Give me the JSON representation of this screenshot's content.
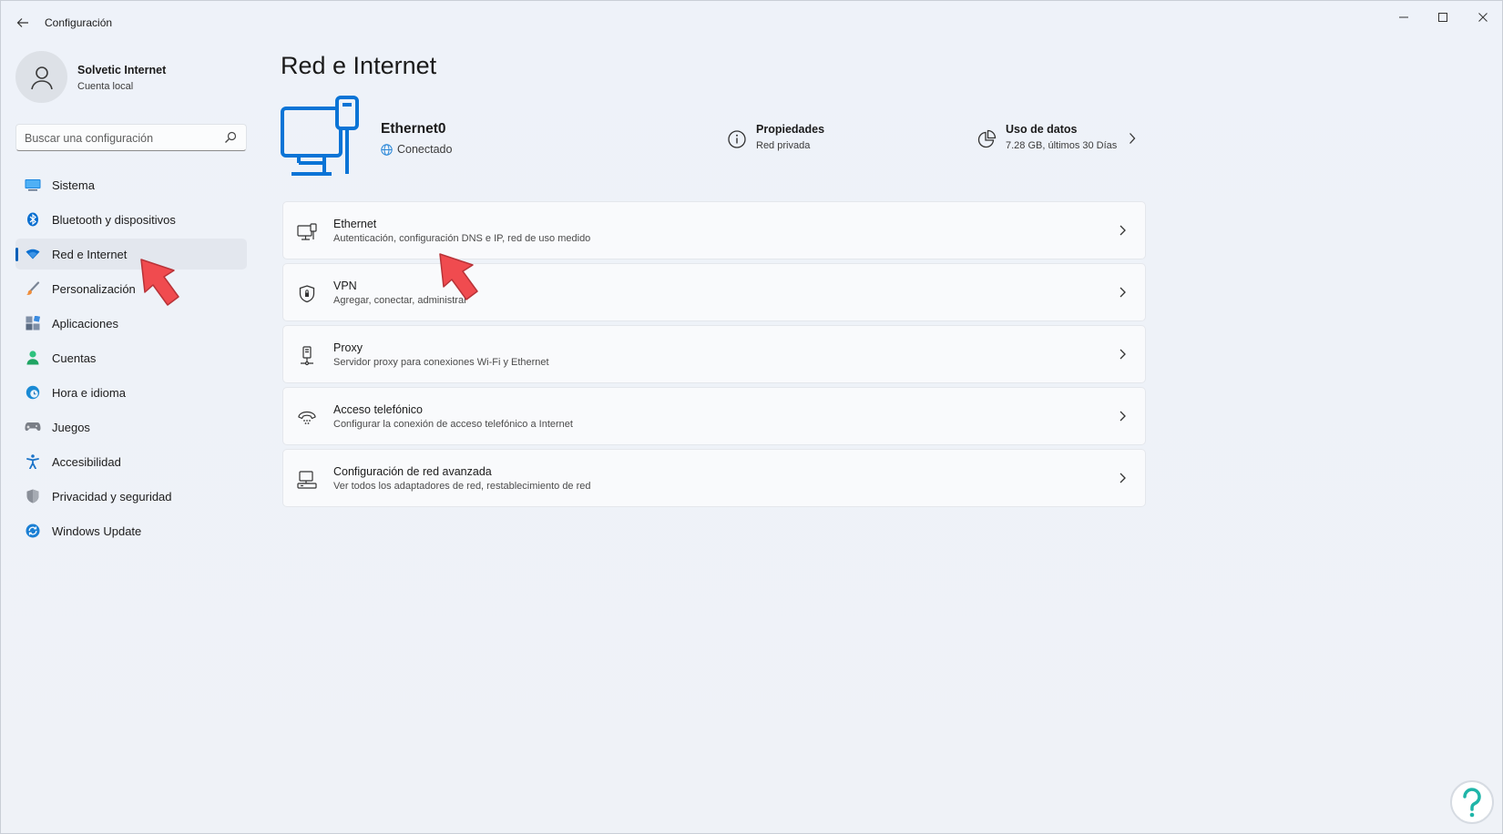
{
  "window": {
    "title": "Configuración",
    "controls": [
      "minimize",
      "maximize",
      "close"
    ]
  },
  "profile": {
    "name": "Solvetic Internet",
    "account_type": "Cuenta local"
  },
  "search": {
    "placeholder": "Buscar una configuración"
  },
  "sidebar": {
    "items": [
      {
        "label": "Sistema",
        "icon": "monitor-icon",
        "color": "#0078d4"
      },
      {
        "label": "Bluetooth y dispositivos",
        "icon": "bluetooth-icon",
        "color": "#0067c0"
      },
      {
        "label": "Red e Internet",
        "icon": "wifi-icon",
        "color": "#0067c0",
        "active": true
      },
      {
        "label": "Personalización",
        "icon": "brush-icon",
        "color": "#e8823a"
      },
      {
        "label": "Aplicaciones",
        "icon": "apps-icon",
        "color": "#5a6b82"
      },
      {
        "label": "Cuentas",
        "icon": "person-icon",
        "color": "#2bb673"
      },
      {
        "label": "Hora e idioma",
        "icon": "globe-clock-icon",
        "color": "#1a8ad4"
      },
      {
        "label": "Juegos",
        "icon": "gamepad-icon",
        "color": "#7a7f87"
      },
      {
        "label": "Accesibilidad",
        "icon": "accessibility-icon",
        "color": "#1a73c8"
      },
      {
        "label": "Privacidad y seguridad",
        "icon": "shield-icon",
        "color": "#8a8f98"
      },
      {
        "label": "Windows Update",
        "icon": "update-icon",
        "color": "#1a7fd4"
      }
    ]
  },
  "main": {
    "title": "Red e Internet",
    "connection": {
      "name": "Ethernet0",
      "status": "Conectado"
    },
    "properties": {
      "title": "Propiedades",
      "subtitle": "Red privada"
    },
    "data_usage": {
      "title": "Uso de datos",
      "subtitle": "7.28 GB, últimos 30 Días"
    },
    "cards": [
      {
        "title": "Ethernet",
        "subtitle": "Autenticación, configuración DNS e IP, red de uso medido",
        "icon": "ethernet-icon"
      },
      {
        "title": "VPN",
        "subtitle": "Agregar, conectar, administrar",
        "icon": "vpn-shield-icon"
      },
      {
        "title": "Proxy",
        "subtitle": "Servidor proxy para conexiones Wi-Fi y Ethernet",
        "icon": "proxy-icon"
      },
      {
        "title": "Acceso telefónico",
        "subtitle": "Configurar la conexión de acceso telefónico a Internet",
        "icon": "dialup-icon"
      },
      {
        "title": "Configuración de red avanzada",
        "subtitle": "Ver todos los adaptadores de red, restablecimiento de red",
        "icon": "network-adapter-icon"
      }
    ]
  },
  "colors": {
    "accent": "#005fb8",
    "hero_blue": "#0a74d6",
    "annotation_arrow": "#f04b4f"
  }
}
